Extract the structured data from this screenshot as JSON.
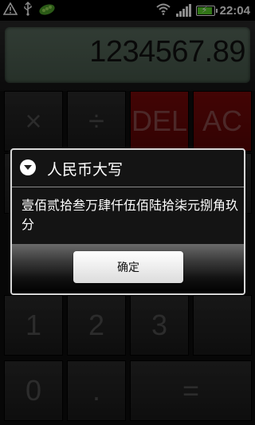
{
  "status_bar": {
    "time": "22:04"
  },
  "display": {
    "value": "1234567.89"
  },
  "keypad": {
    "row1": [
      "×",
      "÷",
      "DEL",
      "AC"
    ],
    "row4": [
      "1",
      "2",
      "3"
    ],
    "row5": [
      "0",
      ".",
      "="
    ]
  },
  "dialog": {
    "title": "人民币大写",
    "message": "壹佰贰拾叁万肆仟伍佰陆拾柒元捌角玖分",
    "ok_label": "确定"
  }
}
